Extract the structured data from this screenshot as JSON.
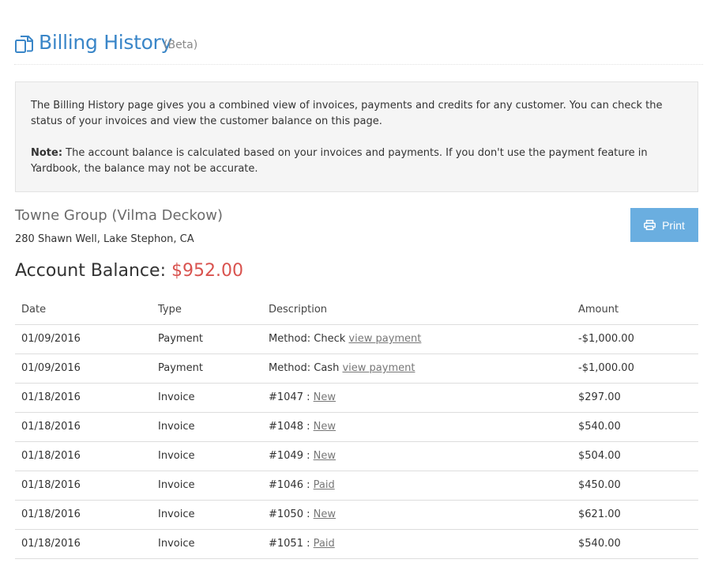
{
  "header": {
    "title": "Billing History",
    "beta": "(Beta)",
    "icon": "documents-icon"
  },
  "note": {
    "paragraph": "The Billing History page gives you a combined view of invoices, payments and credits for any customer. You can check the status of your invoices and view the customer balance on this page.",
    "note_label": "Note:",
    "note_text": " The account balance is calculated based on your invoices and payments. If you don't use the payment feature in Yardbook, the balance may not be accurate."
  },
  "customer": {
    "name": "Towne Group (Vilma Deckow)",
    "address": "280 Shawn Well, Lake Stephon, CA"
  },
  "print_label": "Print",
  "balance": {
    "label": "Account Balance:",
    "amount": "$952.00"
  },
  "table": {
    "headers": [
      "Date",
      "Type",
      "Description",
      "Amount"
    ],
    "rows": [
      {
        "date": "01/09/2016",
        "type": "Payment",
        "desc": "Method: Check ",
        "link": "view payment",
        "amount": "-$1,000.00"
      },
      {
        "date": "01/09/2016",
        "type": "Payment",
        "desc": "Method: Cash ",
        "link": "view payment",
        "amount": "-$1,000.00"
      },
      {
        "date": "01/18/2016",
        "type": "Invoice",
        "desc": "#1047 : ",
        "link": "New",
        "amount": "$297.00"
      },
      {
        "date": "01/18/2016",
        "type": "Invoice",
        "desc": "#1048 : ",
        "link": "New",
        "amount": "$540.00"
      },
      {
        "date": "01/18/2016",
        "type": "Invoice",
        "desc": "#1049 : ",
        "link": "New",
        "amount": "$504.00"
      },
      {
        "date": "01/18/2016",
        "type": "Invoice",
        "desc": "#1046 : ",
        "link": "Paid",
        "amount": "$450.00"
      },
      {
        "date": "01/18/2016",
        "type": "Invoice",
        "desc": "#1050 : ",
        "link": "New",
        "amount": "$621.00"
      },
      {
        "date": "01/18/2016",
        "type": "Invoice",
        "desc": "#1051 : ",
        "link": "Paid",
        "amount": "$540.00"
      }
    ]
  }
}
